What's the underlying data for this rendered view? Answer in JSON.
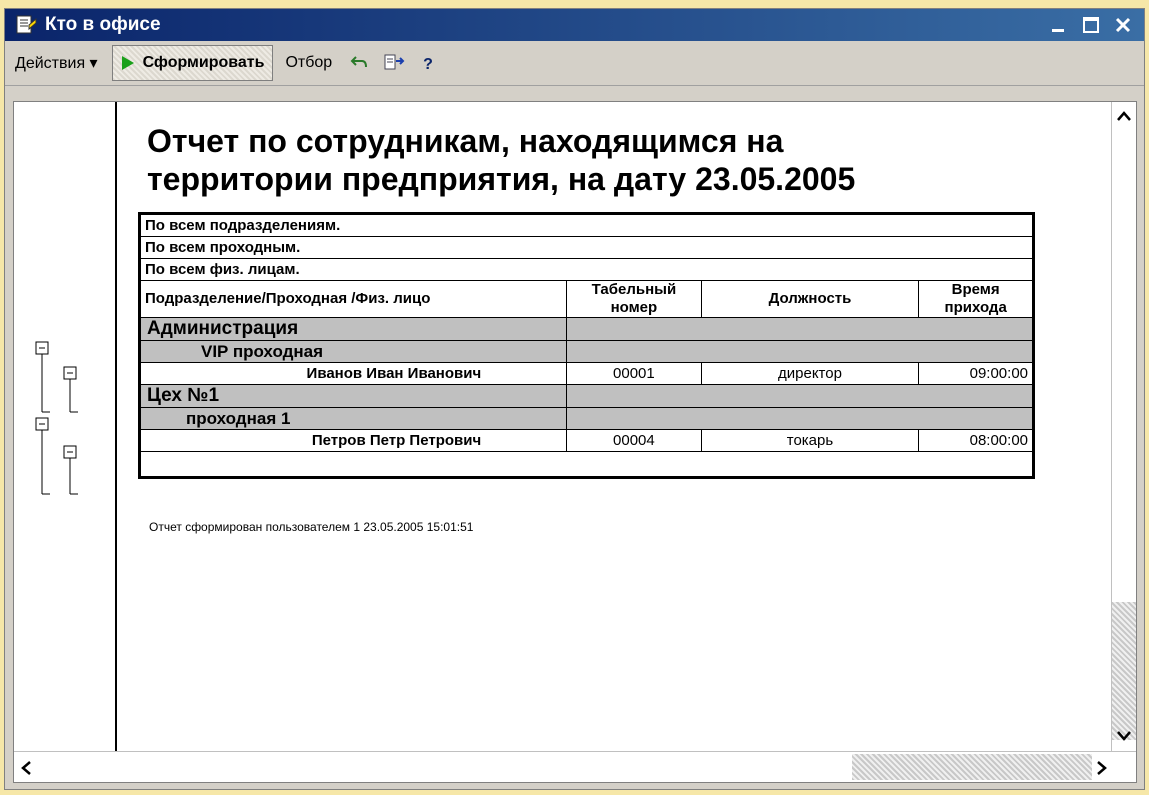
{
  "window": {
    "title": "Кто в офисе",
    "controls": {
      "minimize": "_",
      "maximize": "□",
      "close": "✕"
    }
  },
  "toolbar": {
    "actions_label": "Действия ▾",
    "form_label": "Сформировать",
    "filter_label": "Отбор",
    "help_label": "?"
  },
  "report": {
    "title_line1": "Отчет по сотрудникам, находящимся на",
    "title_line2": "территории предприятия, на дату 23.05.2005",
    "filters": [
      "По всем подразделениям.",
      "По всем проходным.",
      "По всем физ. лицам."
    ],
    "columns": {
      "name": "Подразделение/Проходная /Физ. лицо",
      "number": "Табельный номер",
      "position": "Должность",
      "time": "Время прихода"
    },
    "groups": [
      {
        "department": "Администрация",
        "gate": "VIP проходная",
        "employee": {
          "name": "Иванов Иван Иванович",
          "number": "00001",
          "position": "директор",
          "time": "09:00:00"
        }
      },
      {
        "department": "Цех №1",
        "gate": "проходная 1",
        "employee": {
          "name": "Петров Петр Петрович",
          "number": "00004",
          "position": "токарь",
          "time": "08:00:00"
        }
      }
    ],
    "footer": "Отчет сформирован пользователем 1 23.05.2005 15:01:51"
  },
  "tree": {
    "collapse_symbol": "−"
  }
}
